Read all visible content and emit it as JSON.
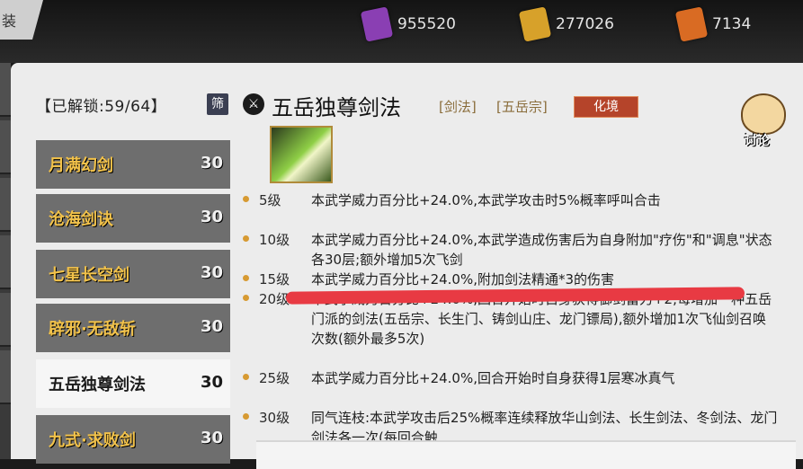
{
  "back_tab": {
    "label": "装"
  },
  "currencies": [
    {
      "icon": "purple-scroll-icon",
      "color": "#8a3fb3",
      "value": "955520"
    },
    {
      "icon": "gold-scroll-icon",
      "color": "#d7a12a",
      "value": "277026"
    },
    {
      "icon": "fire-scroll-icon",
      "color": "#d96b23",
      "value": "7134"
    }
  ],
  "unlock_label": "【已解锁:59/64】",
  "filter_label": "筛",
  "skill_list": [
    {
      "name": "月满幻剑",
      "level": "30"
    },
    {
      "name": "沧海剑诀",
      "level": "30"
    },
    {
      "name": "七星长空剑",
      "level": "30"
    },
    {
      "name": "辟邪·无敌斩",
      "level": "30"
    },
    {
      "name": "五岳独尊剑法",
      "level": "30",
      "selected": true
    },
    {
      "name": "九式·求败剑",
      "level": "30"
    }
  ],
  "detail": {
    "title": "五岳独尊剑法",
    "tag_type": "[剑法]",
    "tag_school": "[五岳宗]",
    "tier": "化境",
    "discuss_label": "讨论",
    "rows": [
      {
        "level": "5级",
        "desc": "本武学威力百分比+24.0%,本武学攻击时5%概率呼叫合击"
      },
      {
        "level": "10级",
        "desc": "本武学威力百分比+24.0%,本武学造成伤害后为自身附加\"疗伤\"和\"调息\"状态各30层;额外增加5次飞剑"
      },
      {
        "level": "15级",
        "desc": "本武学威力百分比+24.0%,附加剑法精通*3的伤害"
      },
      {
        "level": "20级",
        "desc": "本武学威力百分比+24.0%,回合开始时自身获得御剑蓄力+2;每增加一种五岳门派的剑法(五岳宗、长生门、铸剑山庄、龙门镖局),额外增加1次飞仙剑召唤次数(额外最多5次)"
      },
      {
        "level": "25级",
        "desc": "本武学威力百分比+24.0%,回合开始时自身获得1层寒冰真气"
      },
      {
        "level": "30级",
        "desc": "同气连枝:本武学攻击后25%概率连续释放华山剑法、长生剑法、冬剑法、龙门剑法各一次(每回合触"
      }
    ]
  },
  "accent_colors": {
    "gold": "#f2c24a",
    "tier_red": "#b5442a",
    "bullet": "#d79a32",
    "scribble": "#e83a43"
  }
}
